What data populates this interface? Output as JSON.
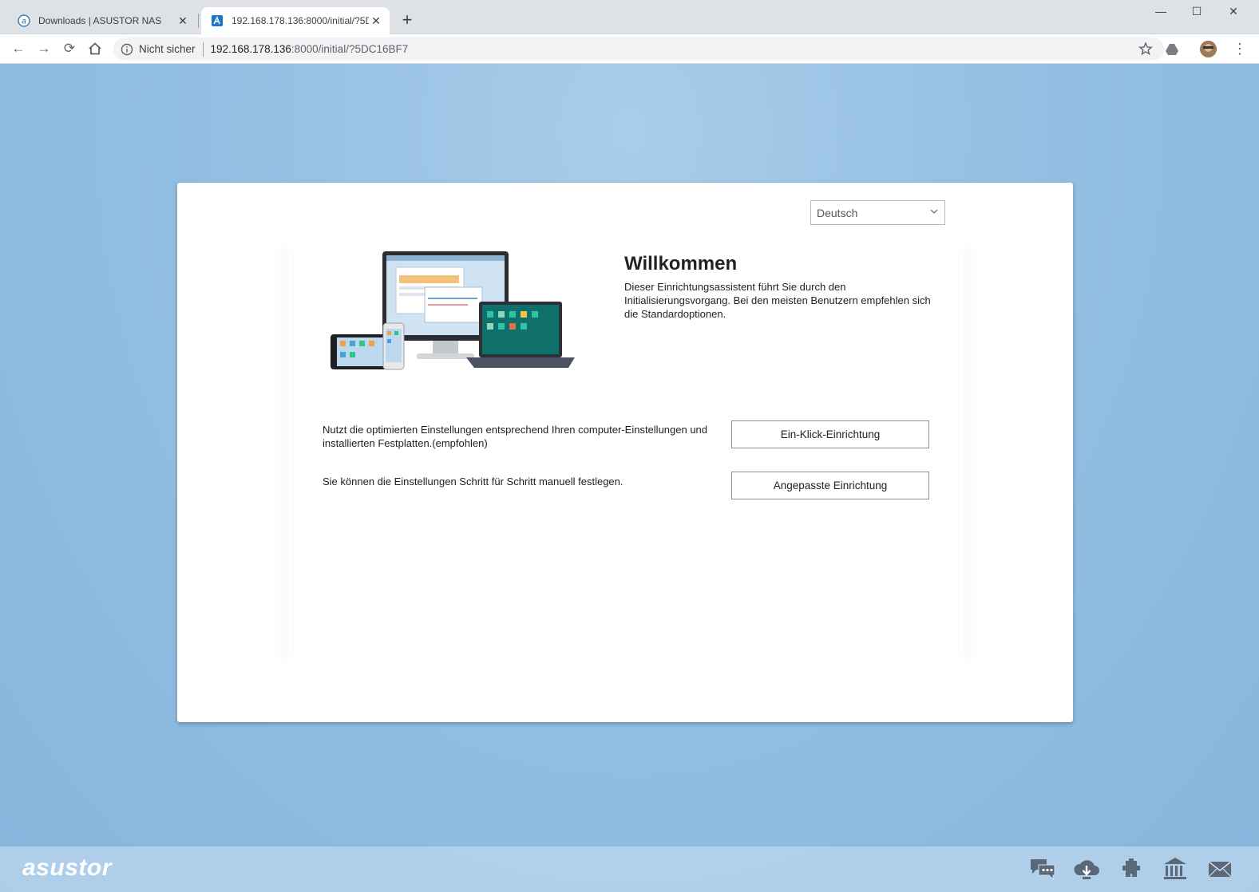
{
  "browser": {
    "tabs": [
      {
        "title": "Downloads | ASUSTOR NAS",
        "active": false
      },
      {
        "title": "192.168.178.136:8000/initial/?5D",
        "active": true
      }
    ],
    "address": {
      "security": "Nicht sicher",
      "host": "192.168.178.136",
      "path": ":8000/initial/?5DC16BF7"
    }
  },
  "dialog": {
    "language": "Deutsch",
    "title": "Willkommen",
    "description": "Dieser Einrichtungsassistent führt Sie durch den Initialisierungsvorgang. Bei den meisten Benutzern empfehlen sich die Standardoptionen.",
    "options": [
      {
        "text": "Nutzt die optimierten Einstellungen entsprechend Ihren computer-Einstellungen und installierten Festplatten.(empfohlen)",
        "button": "Ein-Klick-Einrichtung"
      },
      {
        "text": "Sie können die Einstellungen Schritt für Schritt manuell festlegen.",
        "button": "Angepasste Einrichtung"
      }
    ]
  },
  "footer": {
    "logo": "asustor",
    "icons": [
      "chat-icon",
      "cloud-download-icon",
      "plugin-icon",
      "bank-icon",
      "mail-icon"
    ]
  }
}
